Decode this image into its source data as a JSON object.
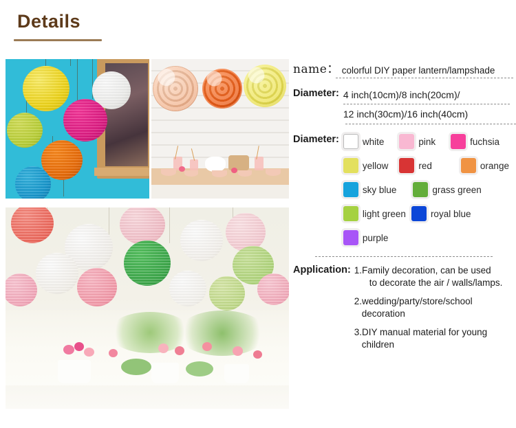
{
  "header": {
    "title": "Details",
    "accent_color": "#5d3a1a",
    "underline_color": "#9b7b55"
  },
  "gallery": {
    "photos": [
      {
        "name": "photo-lanterns-blue-wall",
        "alt": "Colorful round paper lanterns hanging in front of a turquoise wall beside a wooden window"
      },
      {
        "name": "photo-petal-lanterns-table",
        "alt": "Three petal paper lanterns in peach, orange and yellow hanging above a party table"
      },
      {
        "name": "photo-pastel-lanterns-wedding",
        "alt": "Pastel pink, white and green paper lanterns hanging above a floral wedding table"
      }
    ]
  },
  "spec": {
    "name": {
      "label": "name：",
      "value": "colorful DIY paper lantern/lampshade"
    },
    "diameter": {
      "label": "Diameter:",
      "values": [
        "4 inch(10cm)/8 inch(20cm)/",
        "12 inch(30cm)/16 inch(40cm)"
      ]
    },
    "color": {
      "label": "Diameter:",
      "rows": [
        [
          {
            "label": "white",
            "hex": "#ffffff",
            "bordered": true
          },
          {
            "label": "pink",
            "hex": "#f9b8d2",
            "bordered": false
          },
          {
            "label": "fuchsia",
            "hex": "#f73f9b",
            "bordered": false
          }
        ],
        [
          {
            "label": "yellow",
            "hex": "#e3e05e",
            "bordered": false
          },
          {
            "label": "red",
            "hex": "#d83434",
            "bordered": false
          },
          {
            "label": "orange",
            "hex": "#f09343",
            "bordered": false
          }
        ],
        [
          {
            "label": "sky blue",
            "hex": "#16a3dd",
            "bordered": false
          },
          {
            "label": "grass green",
            "hex": "#63ad39",
            "bordered": false
          }
        ],
        [
          {
            "label": "light green",
            "hex": "#a5d141",
            "bordered": false
          },
          {
            "label": "royal blue",
            "hex": "#0c47d8",
            "bordered": false
          }
        ],
        [
          {
            "label": "purple",
            "hex": "#a855f7",
            "bordered": false
          }
        ]
      ]
    },
    "application": {
      "label": "Application:",
      "items": [
        {
          "first": "1.Family decoration, can be used",
          "second": "to decorate the air / walls/lamps."
        },
        {
          "first": "2.wedding/party/store/school",
          "second": "decoration"
        },
        {
          "first": "3.DIY manual material for young",
          "second": "children"
        }
      ]
    }
  }
}
